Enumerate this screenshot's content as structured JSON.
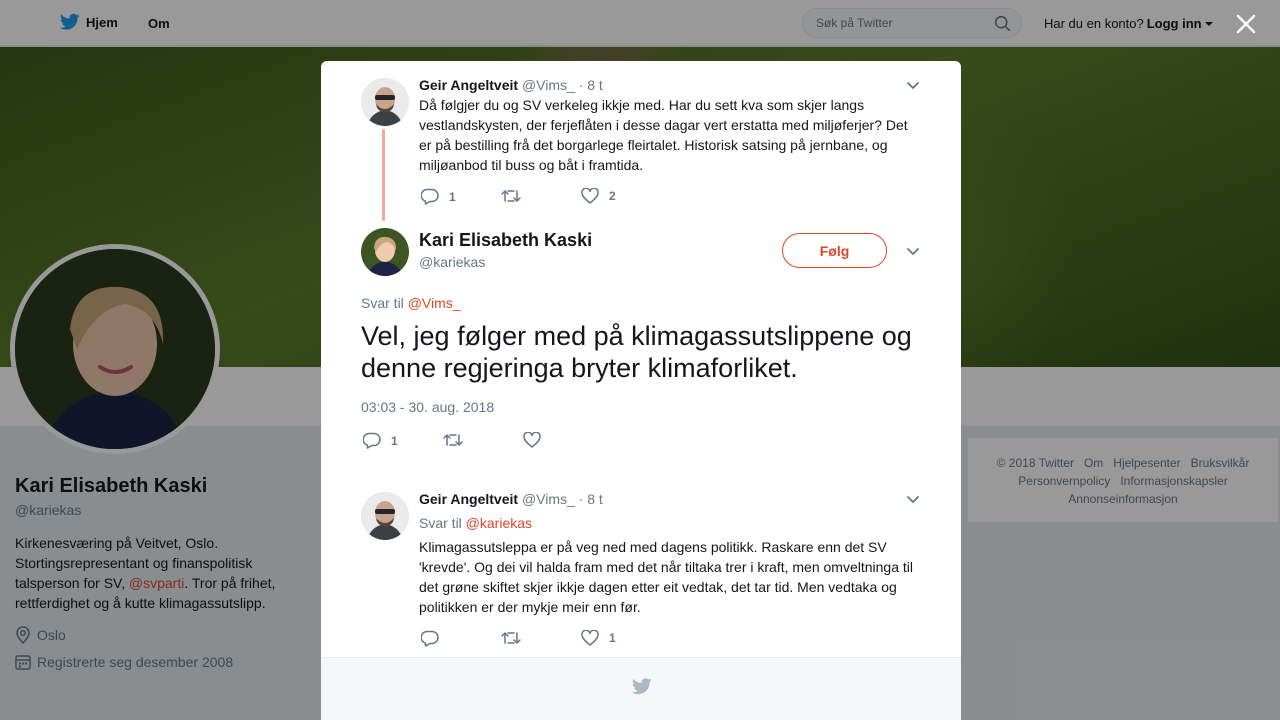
{
  "topbar": {
    "home_label": "Hjem",
    "about_label": "Om",
    "search_placeholder": "Søk på Twitter",
    "account_question": "Har du en konto?",
    "login_label": "Logg inn",
    "brand_color": "#1da1f2"
  },
  "profile": {
    "name": "Kari Elisabeth Kaski",
    "handle": "@kariekas",
    "bio_before": "Kirkenesværing på Veitvet, Oslo. Stortingsrepresentant og finanspolitisk talsperson for SV, ",
    "bio_mention": "@svparti",
    "bio_after": ". Tror på frihet, rettferdighet og å kutte klimagassutslipp.",
    "location": "Oslo",
    "joined": "Registrerte seg desember 2008"
  },
  "footer": {
    "links": [
      "© 2018 Twitter",
      "Om",
      "Hjelpesenter",
      "Bruksvilkår",
      "Personvernpolicy",
      "Informasjonskapsler",
      "Annonseinformasjon"
    ]
  },
  "modal": {
    "accent_color": "#e0452a",
    "parent_tweet": {
      "name": "Geir Angeltveit",
      "handle": "@Vims_",
      "time": "· 8 t",
      "text": "Då følgjer du og SV verkeleg ikkje med. Har du sett kva som skjer langs vestlandskysten, der ferjeflåten i desse dagar vert erstatta med miljøferjer? Det er på bestilling frå det borgarlege fleirtalet. Historisk satsing på jernbane, og miljøanbod til buss og båt i framtida.",
      "replies": "1",
      "likes": "2"
    },
    "main_tweet": {
      "name": "Kari Elisabeth Kaski",
      "handle": "@kariekas",
      "follow_label": "Følg",
      "reply_prefix": "Svar til",
      "reply_mention": "@Vims_",
      "text": "Vel, jeg følger med på klimagassutslippene og denne regjeringa bryter klimaforliket.",
      "timestamp": "03:03 - 30. aug. 2018",
      "replies": "1"
    },
    "reply_tweet": {
      "name": "Geir Angeltveit",
      "handle": "@Vims_",
      "time": "· 8 t",
      "reply_prefix": "Svar til",
      "reply_mention": "@kariekas",
      "text": "Klimagassutsleppa er på veg ned med dagens politikk. Raskare enn det SV 'krevde'. Og dei vil halda fram med det når tiltaka trer i kraft, men omveltninga til det grøne skiftet skjer ikkje dagen etter eit vedtak, det tar tid. Men vedtaka og politikken er der mykje meir enn før.",
      "likes": "1"
    }
  }
}
